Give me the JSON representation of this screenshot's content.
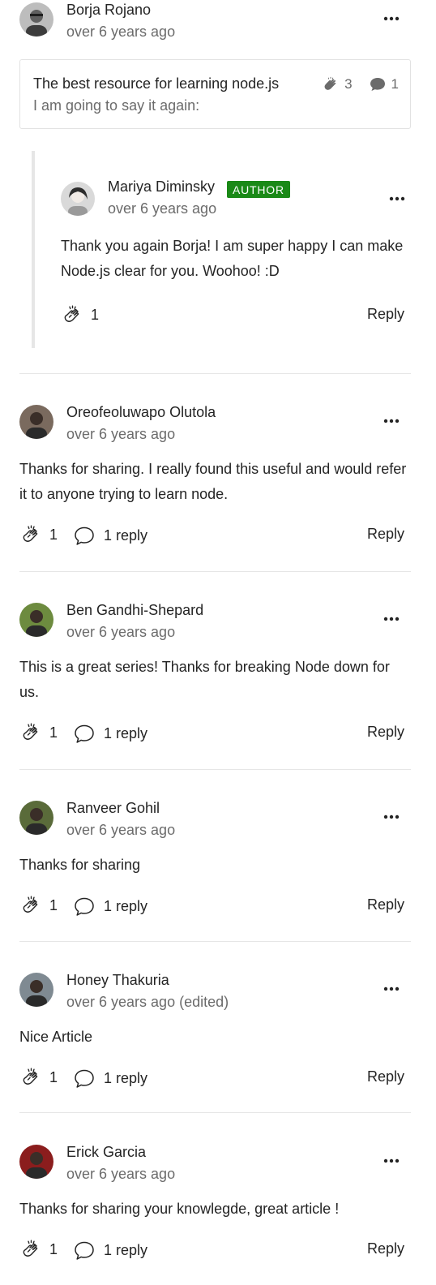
{
  "top_comment": {
    "author": "Borja Rojano",
    "time": "over 6 years ago",
    "quote": {
      "title": "The best resource for learning node.js",
      "subtitle": "I am going to say it again:",
      "claps": "3",
      "responses": "1"
    }
  },
  "author_reply": {
    "author": "Mariya Diminsky",
    "badge": "AUTHOR",
    "time": "over 6 years ago",
    "text": "Thank you again Borja! I am super happy I can make Node.js clear for you. Woohoo! :D",
    "claps": "1",
    "reply_label": "Reply"
  },
  "comments": [
    {
      "author": "Oreofeoluwapo Olutola",
      "time": "over 6 years ago",
      "text": "Thanks for sharing. I really found this useful and would refer it to anyone trying to learn node.",
      "claps": "1",
      "replies": "1 reply",
      "reply_label": "Reply",
      "avatar_color": "#7a6a5e"
    },
    {
      "author": "Ben Gandhi-Shepard",
      "time": "over 6 years ago",
      "text": "This is a great series! Thanks for breaking Node down for us.",
      "claps": "1",
      "replies": "1 reply",
      "reply_label": "Reply",
      "avatar_color": "#6d8b3f"
    },
    {
      "author": "Ranveer Gohil",
      "time": "over 6 years ago",
      "text": "Thanks for sharing",
      "claps": "1",
      "replies": "1 reply",
      "reply_label": "Reply",
      "avatar_color": "#5a6b3a"
    },
    {
      "author": "Honey Thakuria",
      "time": "over 6 years ago (edited)",
      "text": "Nice Article",
      "claps": "1",
      "replies": "1 reply",
      "reply_label": "Reply",
      "avatar_color": "#7f8a92"
    },
    {
      "author": "Erick Garcia",
      "time": "over 6 years ago",
      "text": "Thanks for sharing your knowlegde, great article !",
      "claps": "1",
      "replies": "1 reply",
      "reply_label": "Reply",
      "avatar_color": "#8b1d1d"
    }
  ],
  "colors": {
    "author_badge": "#1a8917",
    "secondary_text": "#6b6b6b",
    "divider": "#e6e6e6"
  },
  "icons": {
    "clap": "clap-icon",
    "reply": "speech-bubble-icon",
    "more": "more-options-icon"
  }
}
